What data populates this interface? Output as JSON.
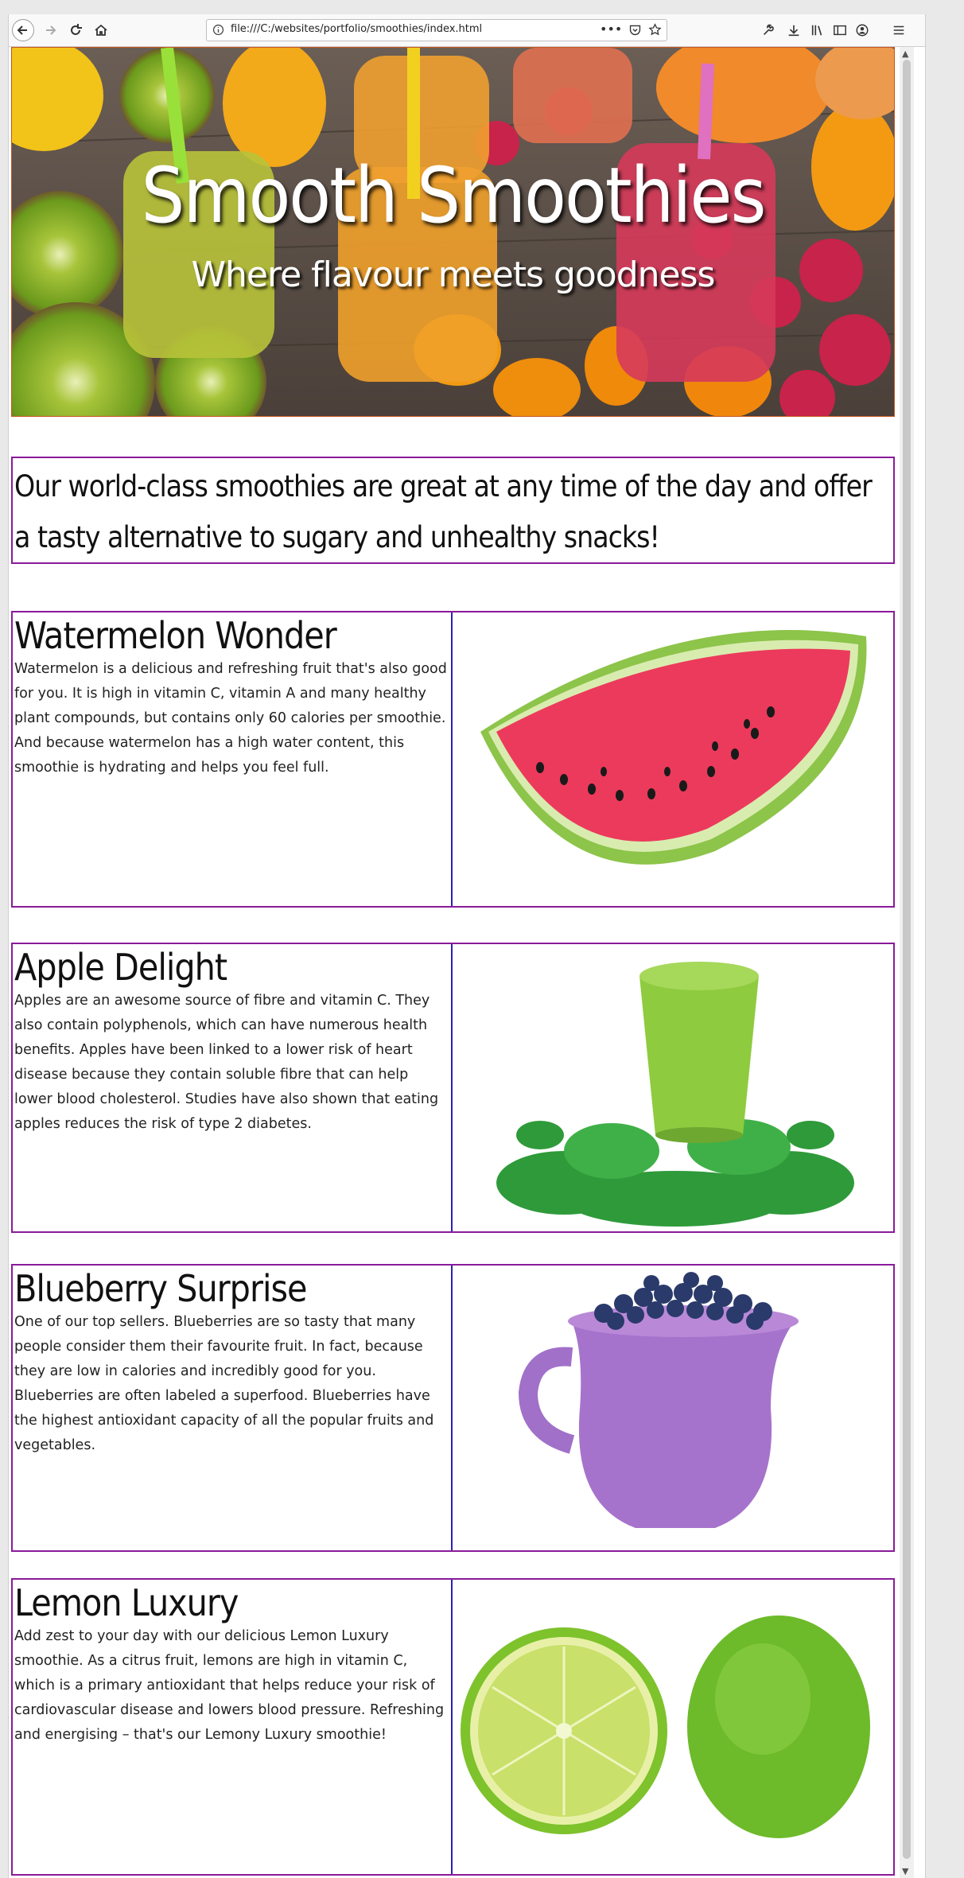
{
  "browser": {
    "url": "file:///C:/websites/portfolio/smoothies/index.html"
  },
  "hero": {
    "title": "Smooth Smoothies",
    "subtitle": "Where flavour meets goodness"
  },
  "intro": {
    "text": "Our world-class smoothies are great at any time of the day and offer a tasty alternative to sugary and unhealthy snacks!"
  },
  "sections": [
    {
      "title": "Watermelon Wonder",
      "body": "Watermelon is a delicious and refreshing fruit that's also good for you. It is high in vitamin C, vitamin A and many healthy plant compounds, but contains only 60 calories per smoothie. And because watermelon has a high water content, this smoothie is hydrating and helps you feel full.",
      "image": "watermelon-slice"
    },
    {
      "title": "Apple Delight",
      "body": "Apples are an awesome source of fibre and vitamin C. They also contain polyphenols, which can have numerous health benefits. Apples have been linked to a lower risk of heart disease because they contain soluble fibre that can help lower blood cholesterol. Studies have also shown that eating apples reduces the risk of type 2 diabetes.",
      "image": "green-smoothie-with-spinach"
    },
    {
      "title": "Blueberry Surprise",
      "body": "One of our top sellers. Blueberries are so tasty that many people consider them their favourite fruit. In fact, because they are low in calories and incredibly good for you. Blueberries are often labeled a superfood. Blueberries have the highest antioxidant capacity of all the popular fruits and vegetables.",
      "image": "jug-of-blueberries"
    },
    {
      "title": "Lemon Luxury",
      "body": "Add zest to your day with our delicious Lemon Luxury smoothie. As a citrus fruit, lemons are high in vitamin C, which is a primary antioxidant that helps reduce your risk of cardiovascular disease and lowers blood pressure. Refreshing and energising – that's our Lemony Luxury smoothie!",
      "image": "limes"
    }
  ]
}
